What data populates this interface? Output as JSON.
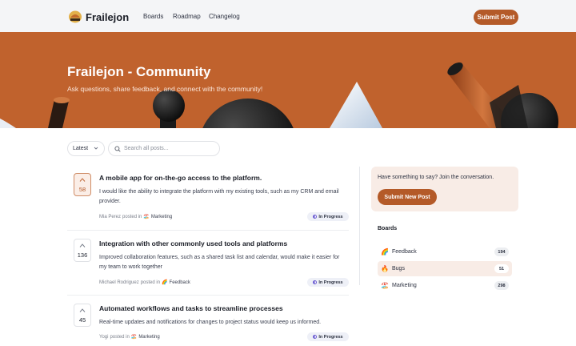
{
  "nav": {
    "brand": "Frailejon",
    "links": [
      "Boards",
      "Roadmap",
      "Changelog"
    ],
    "submit_label": "Submit Post"
  },
  "hero": {
    "title": "Frailejon - Community",
    "subtitle": "Ask questions, share feedback, and connect with the community!"
  },
  "filters": {
    "sort_value": "Latest",
    "search_placeholder": "Search all posts..."
  },
  "posts": [
    {
      "votes": "58",
      "voted": true,
      "title": "A mobile app for on-the-go access to the platform.",
      "body": "I would like the ability to integrate the platform with my existing tools, such as my CRM and email provider.",
      "author": "Mia Perez",
      "posted_in": "posted in",
      "board_emoji": "🏖️",
      "board": "Marketing",
      "status": "In Progress"
    },
    {
      "votes": "136",
      "voted": false,
      "title": "Integration with other commonly used tools and platforms",
      "body": "Improved collaboration features, such as a shared task list and calendar, would make it easier for my team to work together",
      "author": "Michael Rodriguez",
      "posted_in": "posted in",
      "board_emoji": "🌈",
      "board": "Feedback",
      "status": "In Progress"
    },
    {
      "votes": "45",
      "voted": false,
      "title": "Automated workflows and tasks to streamline processes",
      "body": "Real-time updates and notifications for changes to project status would keep us informed.",
      "author": "Yogi",
      "posted_in": "posted in",
      "board_emoji": "🏖️",
      "board": "Marketing",
      "status": "In Progress"
    }
  ],
  "sidebar": {
    "cta_text": "Have something to say? Join the conversation.",
    "cta_button": "Submit New Post",
    "boards_title": "Boards",
    "boards": [
      {
        "emoji": "🌈",
        "name": "Feedback",
        "count": "194",
        "active": false
      },
      {
        "emoji": "🔥",
        "name": "Bugs",
        "count": "51",
        "active": true
      },
      {
        "emoji": "🏖️",
        "name": "Marketing",
        "count": "298",
        "active": false
      }
    ]
  },
  "colors": {
    "accent": "#b45a28",
    "hero_bg": "#c0622d",
    "status_purple": "#6b5bd2"
  },
  "icons": [
    "frailejon-logo-icon",
    "chevron-down-icon",
    "search-icon",
    "upvote-arrow-icon",
    "progress-status-icon"
  ]
}
